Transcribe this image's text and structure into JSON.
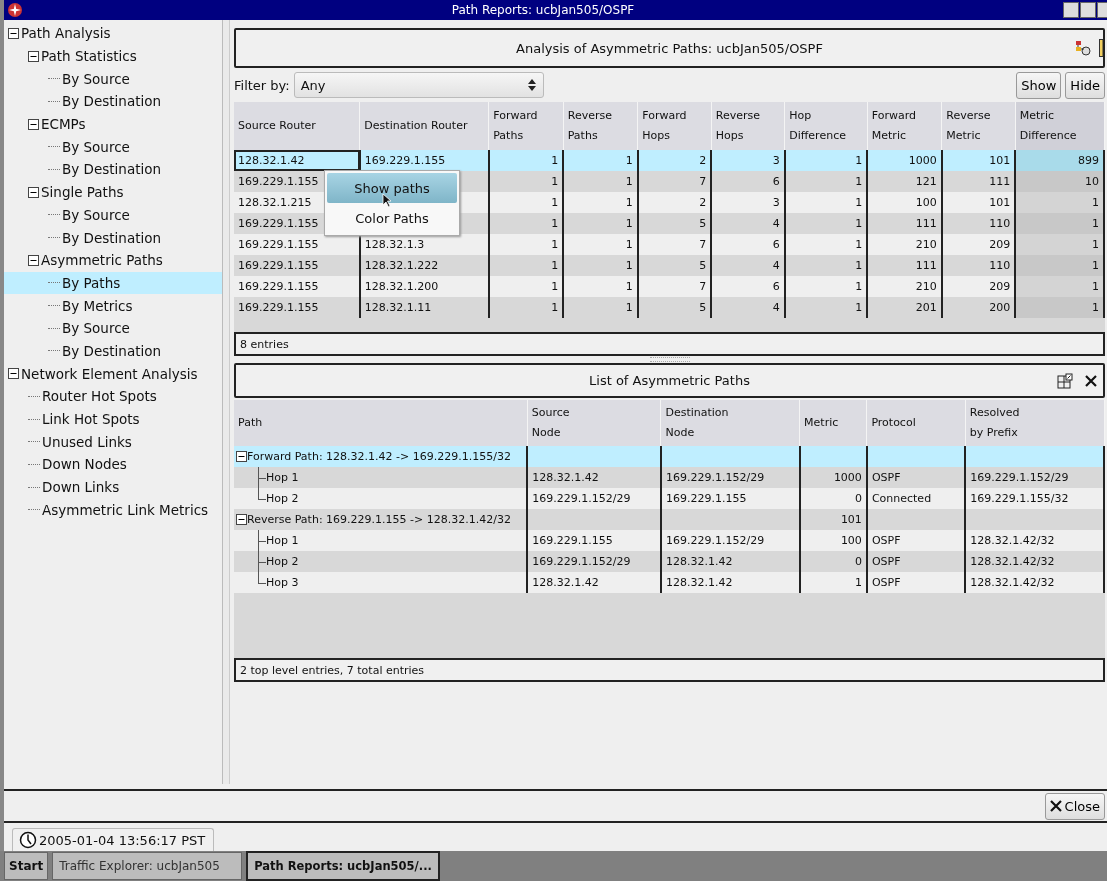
{
  "window": {
    "title": "Path Reports: ucbJan505/OSPF"
  },
  "sidebar": {
    "items": [
      {
        "label": "Path Analysis",
        "expanded": true,
        "selected": false,
        "children": [
          {
            "label": "Path Statistics",
            "expanded": true,
            "selected": false,
            "children": [
              {
                "label": "By Source",
                "selected": false
              },
              {
                "label": "By Destination",
                "selected": false
              }
            ]
          },
          {
            "label": "ECMPs",
            "expanded": true,
            "selected": false,
            "children": [
              {
                "label": "By Source",
                "selected": false
              },
              {
                "label": "By Destination",
                "selected": false
              }
            ]
          },
          {
            "label": "Single Paths",
            "expanded": true,
            "selected": false,
            "children": [
              {
                "label": "By Source",
                "selected": false
              },
              {
                "label": "By Destination",
                "selected": false
              }
            ]
          },
          {
            "label": "Asymmetric Paths",
            "expanded": true,
            "selected": false,
            "children": [
              {
                "label": "By Paths",
                "selected": true
              },
              {
                "label": "By Metrics",
                "selected": false
              },
              {
                "label": "By Source",
                "selected": false
              },
              {
                "label": "By Destination",
                "selected": false
              }
            ]
          }
        ]
      },
      {
        "label": "Network Element Analysis",
        "expanded": true,
        "selected": false,
        "children": [
          {
            "label": "Router Hot Spots",
            "selected": false
          },
          {
            "label": "Link Hot Spots",
            "selected": false
          },
          {
            "label": "Unused Links",
            "selected": false
          },
          {
            "label": "Down Nodes",
            "selected": false
          },
          {
            "label": "Down Links",
            "selected": false
          },
          {
            "label": "Asymmetric Link Metrics",
            "selected": false
          }
        ]
      }
    ]
  },
  "analysis_panel": {
    "title": "Analysis of Asymmetric Paths: ucbJan505/OSPF",
    "filter": {
      "label": "Filter by:",
      "value": "Any"
    },
    "buttons": [
      "Show",
      "Hide"
    ],
    "columns": [
      {
        "label": "Source Router",
        "highlighted": false
      },
      {
        "label": "Destination Router",
        "highlighted": false
      },
      {
        "label": "Forward\nPaths",
        "highlighted": false
      },
      {
        "label": "Reverse\nPaths",
        "highlighted": false
      },
      {
        "label": "Forward\nHops",
        "highlighted": false
      },
      {
        "label": "Reverse\nHops",
        "highlighted": false
      },
      {
        "label": "Hop\nDifference",
        "highlighted": false
      },
      {
        "label": "Forward\nMetric",
        "highlighted": false
      },
      {
        "label": "Reverse\nMetric",
        "highlighted": false
      },
      {
        "label": "Metric\nDifference",
        "highlighted": true
      }
    ],
    "rows": [
      {
        "source": "128.32.1.42",
        "destination": "169.229.1.155",
        "values": [
          "1",
          "1",
          "2",
          "3",
          "1",
          "1000",
          "101",
          "899"
        ],
        "selected": true
      },
      {
        "source": "169.229.1.155",
        "values": [
          "1",
          "1",
          "7",
          "6",
          "1",
          "121",
          "111",
          "10"
        ],
        "selected": false
      },
      {
        "source": "128.32.1.215",
        "values": [
          "1",
          "1",
          "2",
          "3",
          "1",
          "100",
          "101",
          "1"
        ],
        "selected": false
      },
      {
        "source": "169.229.1.155",
        "values": [
          "1",
          "1",
          "5",
          "4",
          "1",
          "111",
          "110",
          "1"
        ],
        "selected": false
      },
      {
        "source": "169.229.1.155",
        "destination": "128.32.1.3",
        "values": [
          "1",
          "1",
          "7",
          "6",
          "1",
          "210",
          "209",
          "1"
        ],
        "selected": false
      },
      {
        "source": "169.229.1.155",
        "destination": "128.32.1.222",
        "values": [
          "1",
          "1",
          "5",
          "4",
          "1",
          "111",
          "110",
          "1"
        ],
        "selected": false
      },
      {
        "source": "169.229.1.155",
        "destination": "128.32.1.200",
        "values": [
          "1",
          "1",
          "7",
          "6",
          "1",
          "210",
          "209",
          "1"
        ],
        "selected": false
      },
      {
        "source": "169.229.1.155",
        "destination": "128.32.1.11",
        "values": [
          "1",
          "1",
          "5",
          "4",
          "1",
          "201",
          "200",
          "1"
        ],
        "selected": false
      }
    ],
    "status": "8 entries",
    "context_menu": {
      "items": [
        {
          "label": "Show paths",
          "selected": true
        },
        {
          "label": "Color Paths",
          "selected": false
        }
      ]
    }
  },
  "paths_panel": {
    "title": "List of Asymmetric Paths",
    "columns": [
      "Path",
      "Source\nNode",
      "Destination\nNode",
      "Metric",
      "Protocol",
      "Resolved\nby Prefix"
    ],
    "rows": [
      {
        "path": "Forward Path: 128.32.1.42 -> 169.229.1.155/32",
        "expanded": true,
        "selected": true,
        "children": [
          {
            "path": "Hop 1",
            "source": "128.32.1.42",
            "destination": "169.229.1.152/29",
            "metric": "1000",
            "protocol": "OSPF",
            "prefix": "169.229.1.152/29",
            "selected": false
          },
          {
            "path": "Hop 2",
            "source": "169.229.1.152/29",
            "destination": "169.229.1.155",
            "metric": "0",
            "protocol": "Connected",
            "prefix": "169.229.1.155/32",
            "selected": false
          }
        ]
      },
      {
        "path": "Reverse Path: 169.229.1.155 -> 128.32.1.42/32",
        "metric": "101",
        "expanded": true,
        "selected": false,
        "children": [
          {
            "path": "Hop 1",
            "source": "169.229.1.155",
            "destination": "169.229.1.152/29",
            "metric": "100",
            "protocol": "OSPF",
            "prefix": "128.32.1.42/32",
            "selected": false
          },
          {
            "path": "Hop 2",
            "source": "169.229.1.152/29",
            "destination": "128.32.1.42",
            "metric": "0",
            "protocol": "OSPF",
            "prefix": "128.32.1.42/32",
            "selected": false
          },
          {
            "path": "Hop 3",
            "source": "128.32.1.42",
            "destination": "128.32.1.42",
            "metric": "1",
            "protocol": "OSPF",
            "prefix": "128.32.1.42/32",
            "selected": false
          }
        ]
      }
    ],
    "status": "2 top level entries, 7 total entries"
  },
  "close_button": "Close",
  "clock": "2005-01-04 13:56:17 PST",
  "taskbar": {
    "start": "Start",
    "tasks": [
      {
        "label": "Traffic Explorer: ucbJan505",
        "selected": false
      },
      {
        "label": "Path Reports: ucbJan505/...",
        "selected": true
      }
    ]
  }
}
